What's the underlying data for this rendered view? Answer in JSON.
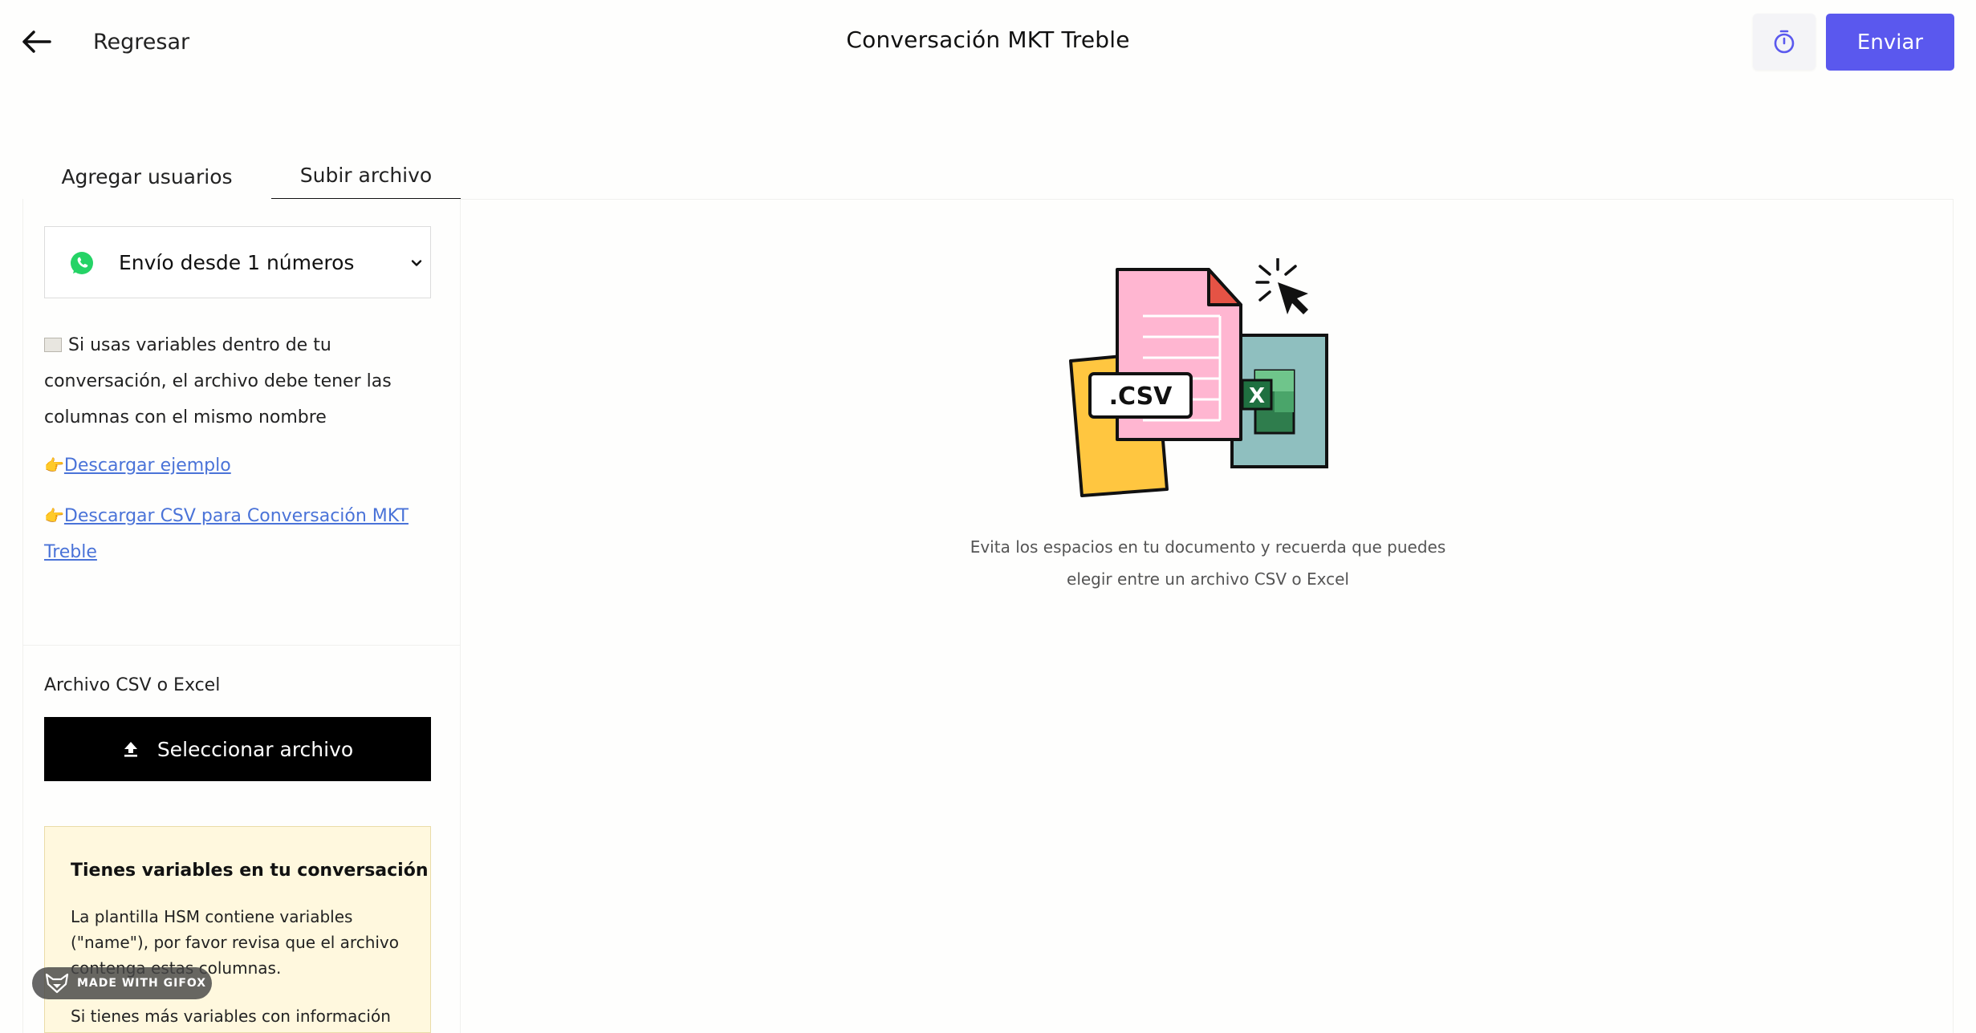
{
  "header": {
    "back_label": "Regresar",
    "title": "Conversación MKT Treble",
    "send_label": "Enviar"
  },
  "tabs": [
    {
      "label": "Agregar usuarios",
      "active": false
    },
    {
      "label": "Subir archivo",
      "active": true
    }
  ],
  "sidebar": {
    "sender_select": {
      "value": "Envío desde 1 números",
      "icon": "whatsapp-icon"
    },
    "info_text": "Si usas variables dentro de tu conversación, el archivo debe tener las columnas con el mismo nombre",
    "links": [
      {
        "emoji": "👉",
        "text": "Descargar ejemplo"
      },
      {
        "emoji": "👉",
        "text": "Descargar CSV para Conversación MKT Treble"
      }
    ],
    "file_label": "Archivo CSV o Excel",
    "select_file_label": "Seleccionar archivo",
    "warning": {
      "title": "Tienes variables en tu conversación",
      "body": "La plantilla HSM contiene variables (\"name\"), por favor revisa que el archivo contenga estas columnas.",
      "body_2": "Si tienes más variables con información"
    }
  },
  "main": {
    "illustration": {
      "csv_label": ".CSV",
      "excel_label": "X"
    },
    "helper_text_1": "Evita los espacios en tu documento y recuerda que puedes",
    "helper_text_2": "elegir entre un archivo CSV o Excel"
  },
  "badge": {
    "text": "MADE WITH GIFOX"
  },
  "colors": {
    "accent": "#5a58ee",
    "link": "#4a73d8",
    "warning_bg": "#fff8de",
    "whatsapp": "#25d366"
  }
}
